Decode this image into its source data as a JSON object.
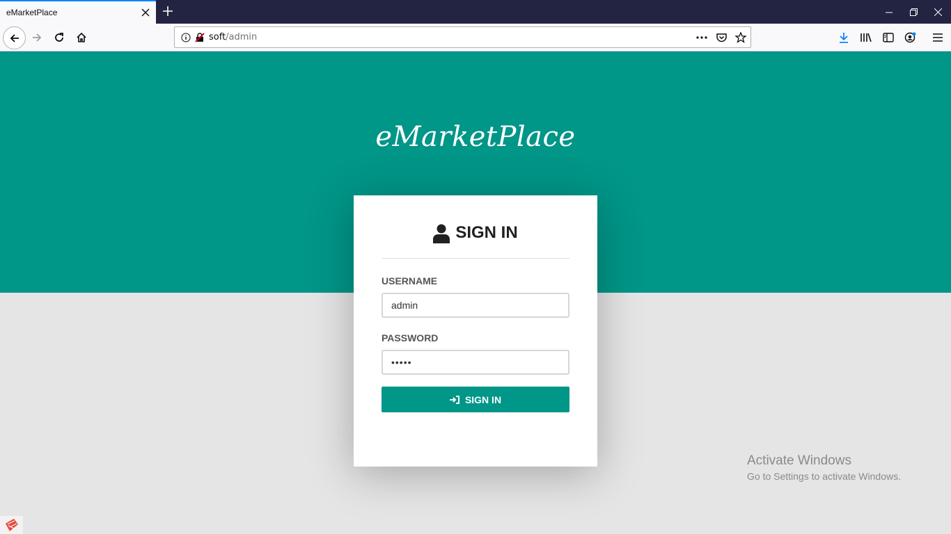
{
  "browser": {
    "tab_title": "eMarketPlace",
    "url_host": "soft",
    "url_path": "/admin"
  },
  "page": {
    "brand": "eMarketPlace",
    "signin_heading": "SIGN IN",
    "username_label": "USERNAME",
    "username_value": "admin",
    "password_label": "PASSWORD",
    "password_value": "•••••",
    "signin_button": "SIGN IN",
    "accent_color": "#009688"
  },
  "os": {
    "watermark_title": "Activate Windows",
    "watermark_subtitle": "Go to Settings to activate Windows."
  },
  "icons": [
    "close-icon",
    "plus-icon",
    "minimize-icon",
    "restore-icon",
    "window-close-icon",
    "back-icon",
    "forward-icon",
    "reload-icon",
    "home-icon",
    "info-icon",
    "insecure-lock-icon",
    "more-icon",
    "pocket-icon",
    "star-icon",
    "download-icon",
    "library-icon",
    "sidebar-icon",
    "account-icon",
    "menu-icon",
    "user-icon",
    "sign-in-icon",
    "app-icon"
  ]
}
